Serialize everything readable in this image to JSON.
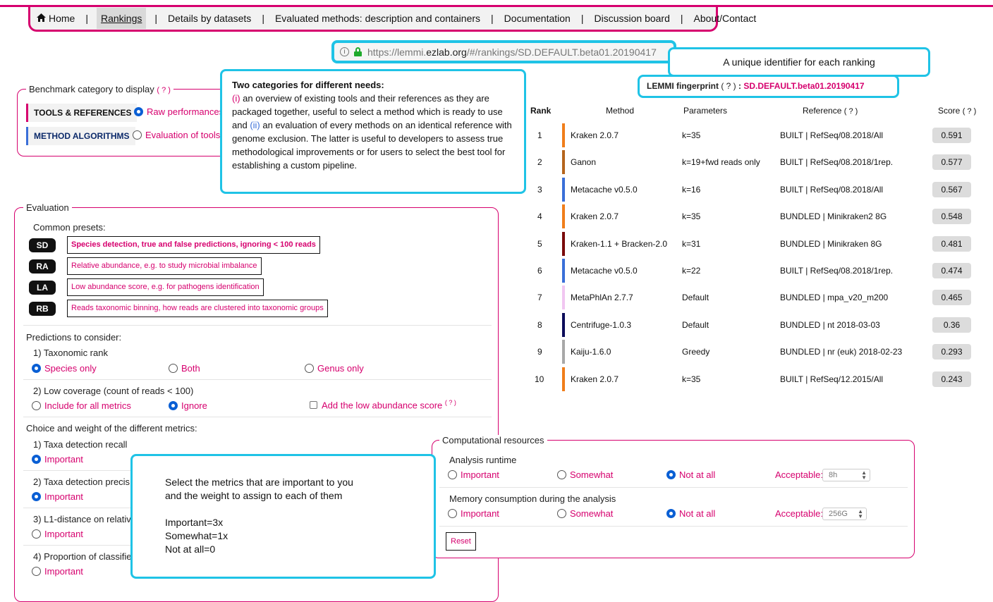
{
  "nav": {
    "items": [
      "Home",
      "Rankings",
      "Details by datasets",
      "Evaluated methods: description and containers",
      "Documentation",
      "Discussion board",
      "About/Contact"
    ],
    "separator": "|",
    "active": "Rankings"
  },
  "url": {
    "prefix": "https://lemmi.",
    "host": "ezlab.org",
    "suffix": "/#/rankings/SD.DEFAULT.beta01.20190417"
  },
  "callouts": {
    "identifier": "A unique identifier for each ranking",
    "categories_title": "Two categories for different needs:",
    "categories_p1": "(i)",
    "categories_t1": " an overview of existing tools and their references as they are packaged together, useful to select a method which is ready to use and ",
    "categories_p2": "(ii)",
    "categories_t2": " an evaluation of every methods on an identical reference with genome exclusion. The latter is useful to developers to assess true methodological improvements or for users to select the best tool for establishing a custom pipeline.",
    "metrics_line1": "Select the metrics that are important to you",
    "metrics_line2": "and the weight to assign to each of them",
    "metrics_line3": "Important=3x",
    "metrics_line4": "Somewhat=1x",
    "metrics_line5": "Not at all=0"
  },
  "fingerprint": {
    "label": "LEMMI fingerprint",
    "help": "( ? )",
    "sep": ":",
    "value": "SD.DEFAULT.beta01.20190417"
  },
  "benchmark": {
    "legend": "Benchmark category to display",
    "help": "( ? )",
    "cat1": "TOOLS & REFERENCES",
    "cat1_option": "Raw performances",
    "cat2": "METHOD ALGORITHMS",
    "cat2_option": "Evaluation of tools"
  },
  "evaluation": {
    "legend": "Evaluation",
    "common_presets": "Common presets:",
    "presets": [
      {
        "code": "SD",
        "desc": "Species detection, true and false predictions, ignoring < 100 reads"
      },
      {
        "code": "RA",
        "desc": "Relative abundance, e.g. to study microbial imbalance"
      },
      {
        "code": "LA",
        "desc": "Low abundance score, e.g. for pathogens identification"
      },
      {
        "code": "RB",
        "desc": "Reads taxonomic binning, how reads are clustered into taxonomic groups"
      }
    ],
    "predictions_title": "Predictions to consider:",
    "rank_title": "1) Taxonomic rank",
    "rank_opts": [
      "Species only",
      "Both",
      "Genus only"
    ],
    "coverage_title": "2) Low coverage (count of reads < 100)",
    "coverage_opts": [
      "Include for all metrics",
      "Ignore"
    ],
    "low_abundance": "Add the low abundance score",
    "low_abundance_help": "( ? )",
    "metrics_title": "Choice and weight of the different metrics:",
    "metrics": [
      {
        "label": "1) Taxa detection recall",
        "opt": "Important"
      },
      {
        "label": "2) Taxa detection precis",
        "opt": "Important"
      },
      {
        "label": "3) L1-distance on relativ",
        "opt": "Important"
      },
      {
        "label": "4) Proportion of classifie",
        "opt": "Important"
      }
    ]
  },
  "ranking": {
    "headers": [
      "Rank",
      "Method",
      "Parameters",
      "Reference",
      "Score"
    ],
    "help": "( ? )",
    "rows": [
      {
        "rank": "1",
        "method": "Kraken 2.0.7",
        "params": "k=35",
        "ref": "BUILT | RefSeq/08.2018/All",
        "score": "0.591",
        "color": "#f07e1b"
      },
      {
        "rank": "2",
        "method": "Ganon",
        "params": "k=19+fwd reads only",
        "ref": "BUILT | RefSeq/08.2018/1rep.",
        "score": "0.577",
        "color": "#b5651d"
      },
      {
        "rank": "3",
        "method": "Metacache v0.5.0",
        "params": "k=16",
        "ref": "BUILT | RefSeq/08.2018/All",
        "score": "0.567",
        "color": "#3a6fd8"
      },
      {
        "rank": "4",
        "method": "Kraken 2.0.7",
        "params": "k=35",
        "ref": "BUNDLED | Minikraken2 8G",
        "score": "0.548",
        "color": "#f07e1b"
      },
      {
        "rank": "5",
        "method": "Kraken-1.1 + Bracken-2.0",
        "params": "k=31",
        "ref": "BUNDLED | Minikraken 8G",
        "score": "0.481",
        "color": "#7a0a0a"
      },
      {
        "rank": "6",
        "method": "Metacache v0.5.0",
        "params": "k=22",
        "ref": "BUILT | RefSeq/08.2018/1rep.",
        "score": "0.474",
        "color": "#3a6fd8"
      },
      {
        "rank": "7",
        "method": "MetaPhlAn 2.7.7",
        "params": "Default",
        "ref": "BUNDLED | mpa_v20_m200",
        "score": "0.465",
        "color": "#f1c6f1"
      },
      {
        "rank": "8",
        "method": "Centrifuge-1.0.3",
        "params": "Default",
        "ref": "BUNDLED | nt 2018-03-03",
        "score": "0.36",
        "color": "#0c0c5a"
      },
      {
        "rank": "9",
        "method": "Kaiju-1.6.0",
        "params": "Greedy",
        "ref": "BUNDLED | nr (euk) 2018-02-23",
        "score": "0.293",
        "color": "#a8a8a8"
      },
      {
        "rank": "10",
        "method": "Kraken 2.0.7",
        "params": "k=35",
        "ref": "BUILT | RefSeq/12.2015/All",
        "score": "0.243",
        "color": "#f07e1b"
      }
    ]
  },
  "computational": {
    "legend": "Computational resources",
    "runtime_title": "Analysis runtime",
    "memory_title": "Memory consumption during the analysis",
    "opts": [
      "Important",
      "Somewhat",
      "Not at all"
    ],
    "acceptable": "Acceptable:",
    "runtime_value": "8h",
    "memory_value": "256G",
    "reset": "Reset"
  }
}
